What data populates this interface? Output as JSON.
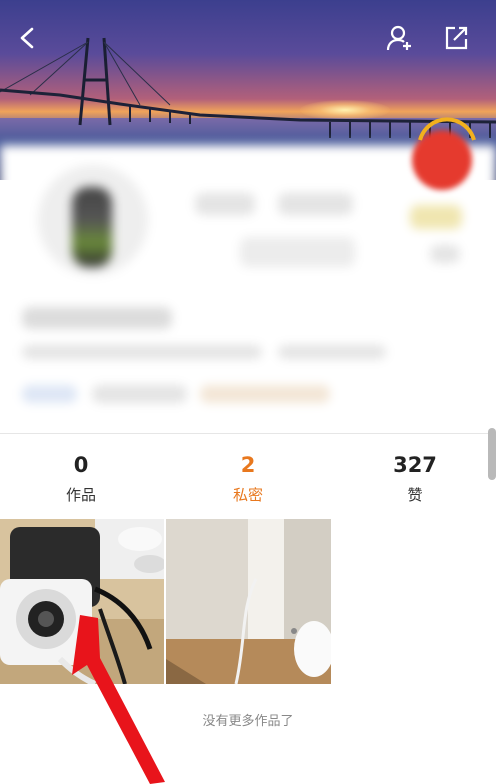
{
  "header": {
    "back_icon": "chevron-left-icon",
    "add_friend_icon": "add-user-icon",
    "share_icon": "share-icon"
  },
  "stats": [
    {
      "count": "0",
      "label": "作品"
    },
    {
      "count": "2",
      "label": "私密"
    },
    {
      "count": "327",
      "label": "赞"
    }
  ],
  "active_color": "#e8781e",
  "footer": {
    "text": "没有更多作品了"
  }
}
